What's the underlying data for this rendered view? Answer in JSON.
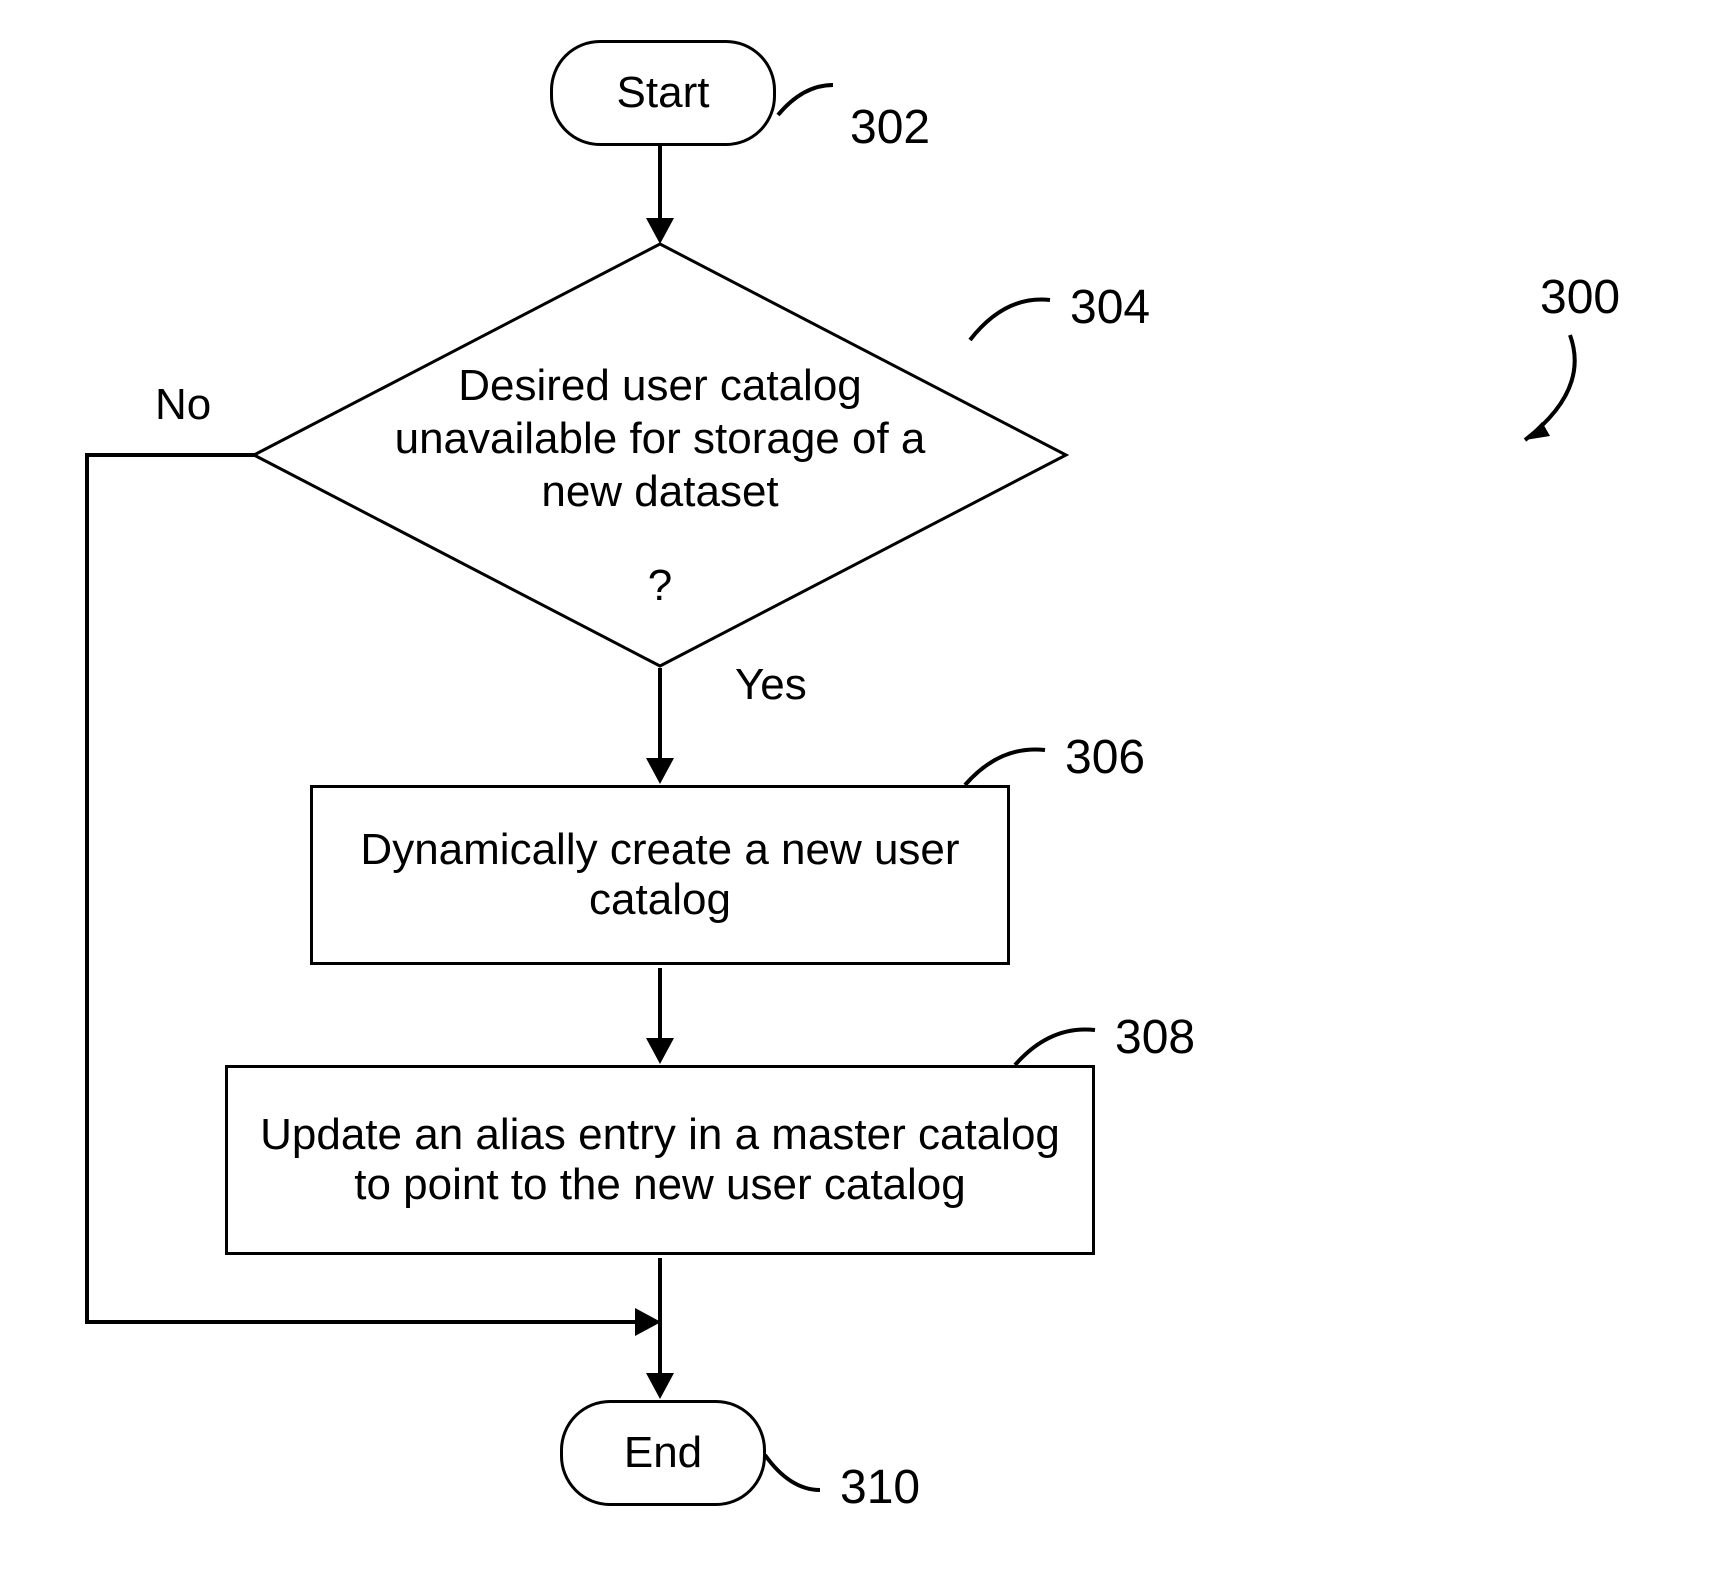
{
  "figure_ref": "300",
  "start": {
    "label": "Start",
    "ref": "302"
  },
  "decision": {
    "text": "Desired user catalog unavailable for storage of a new dataset",
    "question": "?",
    "ref": "304",
    "no_label": "No",
    "yes_label": "Yes"
  },
  "process1": {
    "text": "Dynamically create a new user catalog",
    "ref": "306"
  },
  "process2": {
    "text": "Update an alias entry in a master catalog to point to the new user catalog",
    "ref": "308"
  },
  "end": {
    "label": "End",
    "ref": "310"
  }
}
